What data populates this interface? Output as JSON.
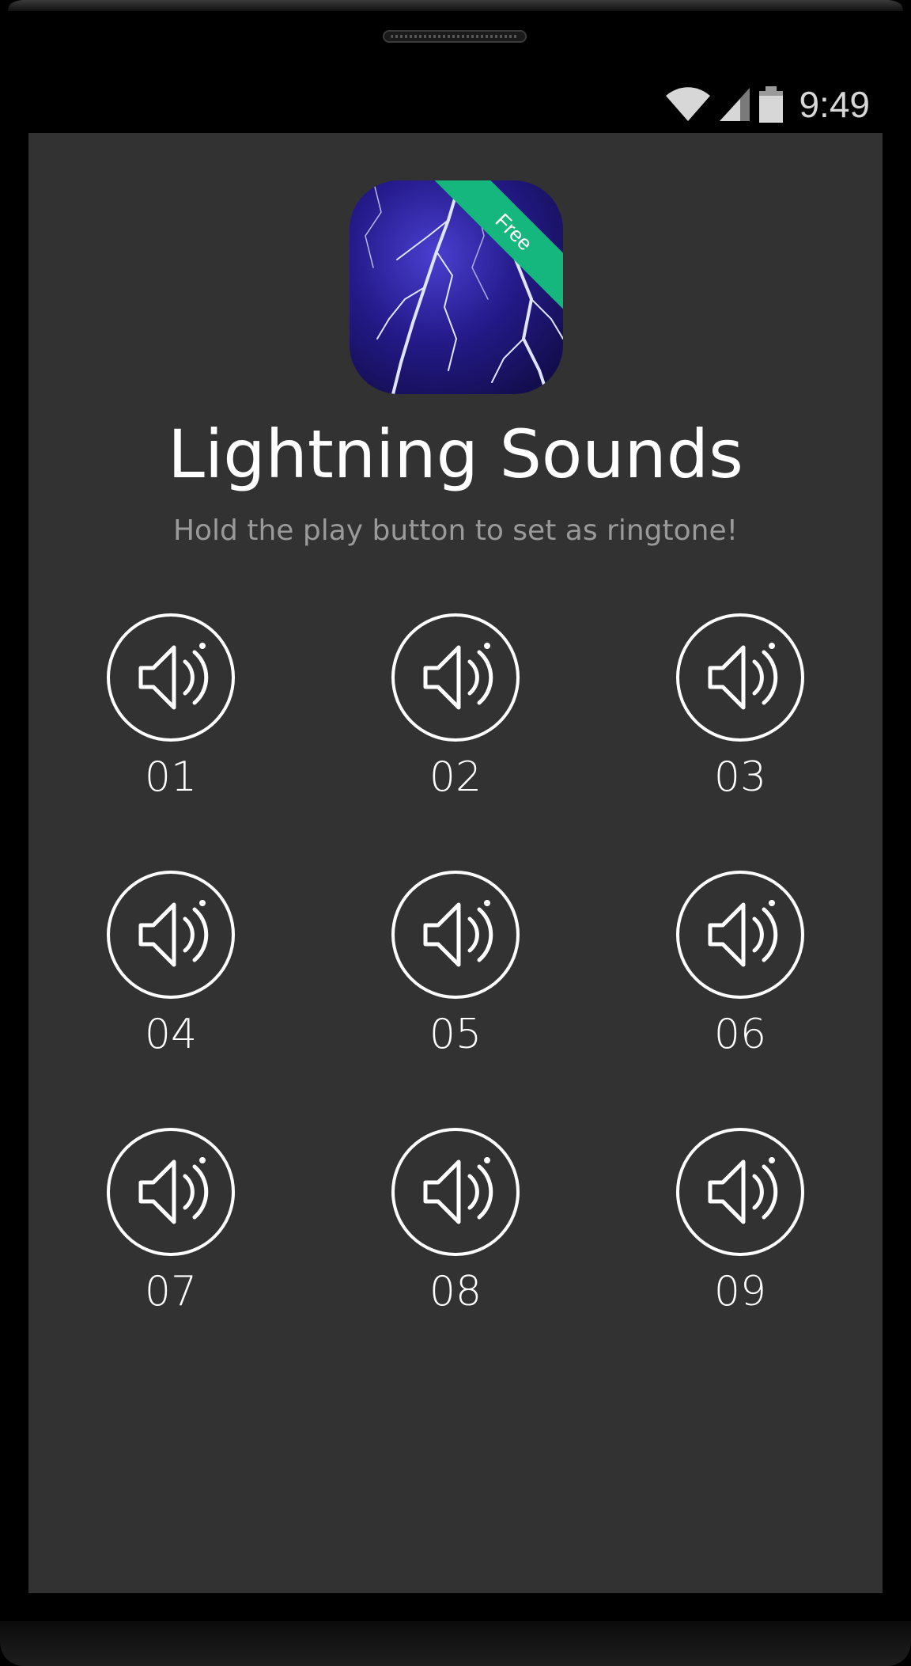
{
  "status_bar": {
    "time": "9:49",
    "icons": [
      "wifi-icon",
      "signal-icon",
      "battery-icon"
    ]
  },
  "app": {
    "badge": "Free",
    "title": "Lightning Sounds",
    "subtitle": "Hold the play button to set as ringtone!"
  },
  "sounds": [
    {
      "label": "01",
      "icon": "speaker-icon"
    },
    {
      "label": "02",
      "icon": "speaker-icon"
    },
    {
      "label": "03",
      "icon": "speaker-icon"
    },
    {
      "label": "04",
      "icon": "speaker-icon"
    },
    {
      "label": "05",
      "icon": "speaker-icon"
    },
    {
      "label": "06",
      "icon": "speaker-icon"
    },
    {
      "label": "07",
      "icon": "speaker-icon"
    },
    {
      "label": "08",
      "icon": "speaker-icon"
    },
    {
      "label": "09",
      "icon": "speaker-icon"
    }
  ],
  "colors": {
    "screen_bg": "#323232",
    "badge": "#15b77f",
    "icon_stroke": "#ffffff",
    "subtitle": "#9a9a9a"
  }
}
